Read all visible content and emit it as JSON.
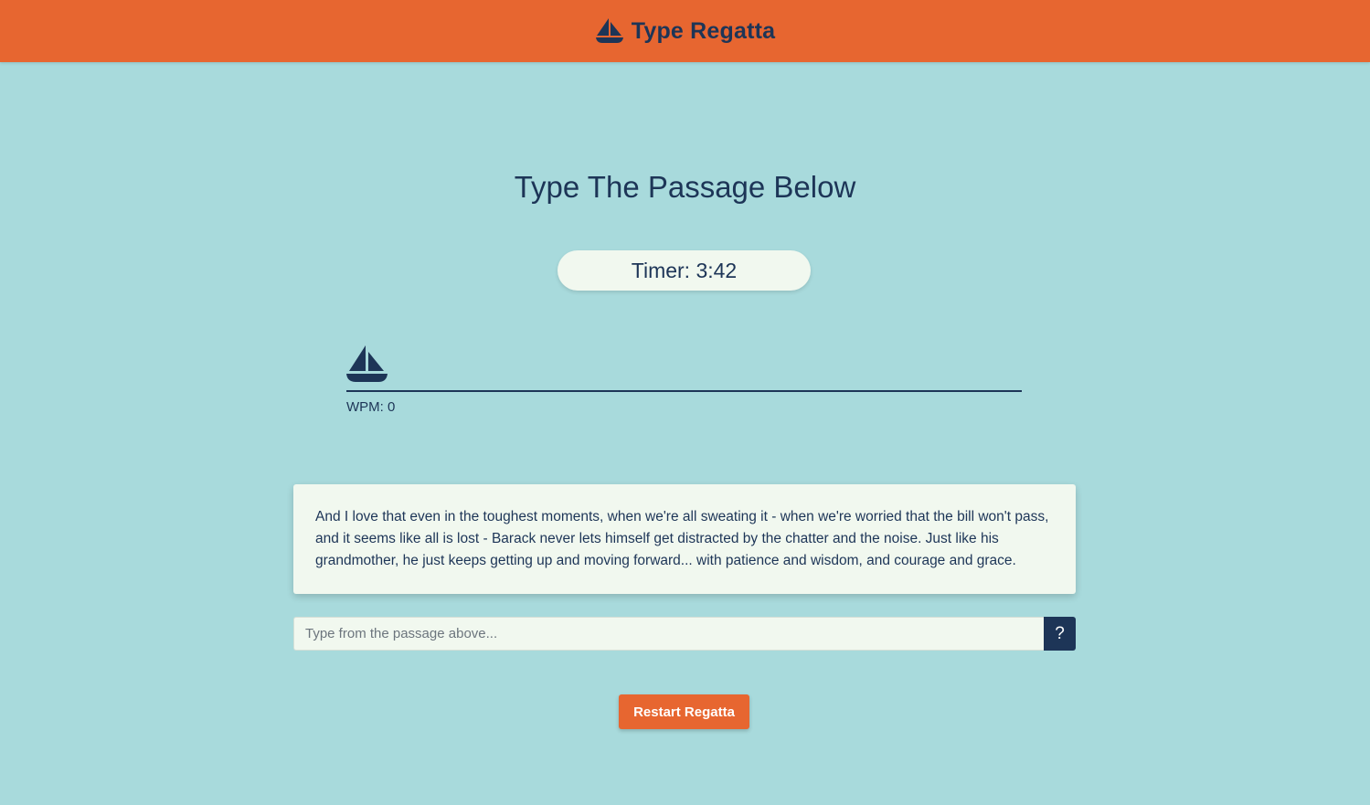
{
  "navbar": {
    "brand_icon": "sailboat-icon",
    "brand_title": "Type Regatta",
    "background_color": "#e76630"
  },
  "main": {
    "heading": "Type The Passage Below",
    "timer_text": "Timer: 3:42",
    "race": {
      "boat_icon": "sailboat-icon",
      "wpm_text": "WPM: 0",
      "progress": 0
    },
    "passage": "And I love that even in the toughest moments, when we're all sweating it - when we're worried that the bill won't pass, and it seems like all is lost - Barack never lets himself get distracted by the chatter and the noise. Just like his grandmother, he just keeps getting up and moving forward... with patience and wisdom, and courage and grace.",
    "input": {
      "value": "",
      "placeholder": "Type from the passage above..."
    },
    "help_label": "?",
    "restart_label": "Restart Regatta"
  },
  "colors": {
    "background": "#a8dadc",
    "accent": "#e76630",
    "navy": "#1d3557",
    "card": "#f1f8ef"
  }
}
